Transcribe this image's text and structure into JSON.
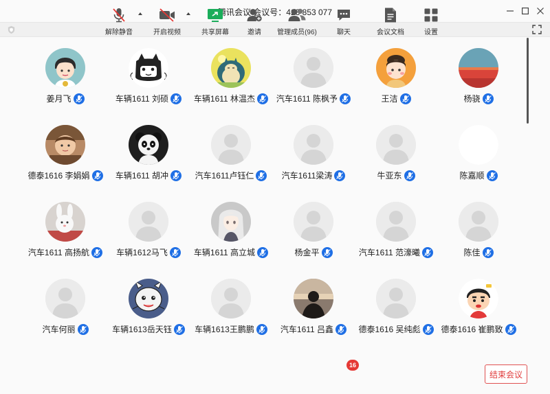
{
  "window": {
    "title": "腾讯会议 会议号：423 853 077"
  },
  "participants": [
    {
      "name": "姜月飞",
      "avatar": "boy-cartoon-avatar"
    },
    {
      "name": "车辆1611 刘硕",
      "avatar": "cat-sketch-avatar"
    },
    {
      "name": "车辆1611  林温杰",
      "avatar": "snorlax-avatar"
    },
    {
      "name": "汽车1611 陈枫予",
      "avatar": "default-avatar"
    },
    {
      "name": "王洁",
      "avatar": "girl-cartoon-avatar"
    },
    {
      "name": "杨骁",
      "avatar": "sunset-avatar"
    },
    {
      "name": "德泰1616 李娟娟",
      "avatar": "baby-photo-avatar"
    },
    {
      "name": "车辆1611  胡冲",
      "avatar": "panda-avatar"
    },
    {
      "name": "汽车1611卢钰仁",
      "avatar": "default-avatar"
    },
    {
      "name": "汽车1611梁涛",
      "avatar": "default-avatar"
    },
    {
      "name": "牛亚东",
      "avatar": "default-avatar"
    },
    {
      "name": "陈嘉顺",
      "avatar": "blank-white-avatar"
    },
    {
      "name": "汽车1611 高扬航",
      "avatar": "bunny-photo-avatar"
    },
    {
      "name": "车辆1612马飞",
      "avatar": "default-avatar"
    },
    {
      "name": "车辆1611 高立城",
      "avatar": "anime-girl-avatar"
    },
    {
      "name": "杨金平",
      "avatar": "default-avatar"
    },
    {
      "name": "汽车1611 范濠曦",
      "avatar": "default-avatar"
    },
    {
      "name": "陈佳",
      "avatar": "default-avatar"
    },
    {
      "name": "汽车何丽",
      "avatar": "default-avatar"
    },
    {
      "name": "车辆1613岳天钰",
      "avatar": "dragon-cartoon-avatar"
    },
    {
      "name": "车辆1613王鹏鹏",
      "avatar": "default-avatar"
    },
    {
      "name": "汽车1611 吕鑫",
      "avatar": "silhouette-photo-avatar"
    },
    {
      "name": "德泰1616 吴纯彪",
      "avatar": "default-avatar"
    },
    {
      "name": "德泰1616 崔鹏致",
      "avatar": "crayon-shin-avatar"
    }
  ],
  "toolbar": {
    "unmute": "解除静音",
    "start_video": "开启视频",
    "share_screen": "共享屏幕",
    "invite": "邀请",
    "manage_members": "管理成员(96)",
    "chat": "聊天",
    "chat_badge": "16",
    "meeting_docs": "会议文档",
    "settings": "设置",
    "end_meeting": "结束会议"
  },
  "colors": {
    "mic_blue": "#1f6fe5",
    "end_red": "#e03c3c",
    "share_green": "#1aad5a",
    "badge_red": "#e53935"
  }
}
